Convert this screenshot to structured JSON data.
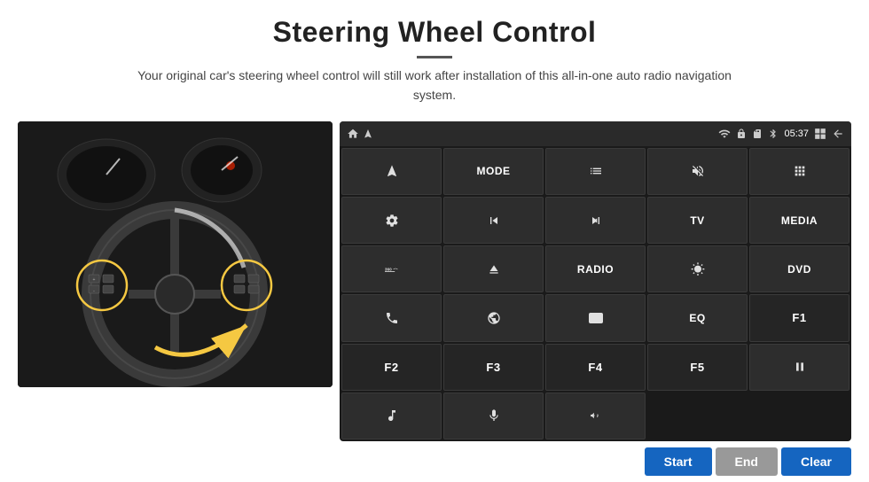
{
  "header": {
    "title": "Steering Wheel Control",
    "subtitle": "Your original car's steering wheel control will still work after installation of this all-in-one auto radio navigation system."
  },
  "statusBar": {
    "time": "05:37",
    "homeIcon": "home-icon",
    "wifiIcon": "wifi-icon",
    "lockIcon": "lock-icon",
    "sdIcon": "sd-icon",
    "bluetoothIcon": "bluetooth-icon",
    "windowsIcon": "windows-icon",
    "backIcon": "back-icon"
  },
  "panelButtons": [
    {
      "id": "b1",
      "type": "icon",
      "icon": "send-icon",
      "label": ""
    },
    {
      "id": "b2",
      "type": "text",
      "icon": "",
      "label": "MODE"
    },
    {
      "id": "b3",
      "type": "icon",
      "icon": "list-icon",
      "label": ""
    },
    {
      "id": "b4",
      "type": "icon",
      "icon": "mute-icon",
      "label": ""
    },
    {
      "id": "b5",
      "type": "icon",
      "icon": "grid-icon",
      "label": ""
    },
    {
      "id": "b6",
      "type": "icon",
      "icon": "settings-icon",
      "label": ""
    },
    {
      "id": "b7",
      "type": "icon",
      "icon": "prev-icon",
      "label": ""
    },
    {
      "id": "b8",
      "type": "icon",
      "icon": "next-icon",
      "label": ""
    },
    {
      "id": "b9",
      "type": "text",
      "icon": "",
      "label": "TV"
    },
    {
      "id": "b10",
      "type": "text",
      "icon": "",
      "label": "MEDIA"
    },
    {
      "id": "b11",
      "type": "icon",
      "icon": "360-icon",
      "label": ""
    },
    {
      "id": "b12",
      "type": "icon",
      "icon": "eject-icon",
      "label": ""
    },
    {
      "id": "b13",
      "type": "text",
      "icon": "",
      "label": "RADIO"
    },
    {
      "id": "b14",
      "type": "icon",
      "icon": "brightness-icon",
      "label": ""
    },
    {
      "id": "b15",
      "type": "text",
      "icon": "",
      "label": "DVD"
    },
    {
      "id": "b16",
      "type": "icon",
      "icon": "phone-icon",
      "label": ""
    },
    {
      "id": "b17",
      "type": "icon",
      "icon": "globe-icon",
      "label": ""
    },
    {
      "id": "b18",
      "type": "icon",
      "icon": "rect-icon",
      "label": ""
    },
    {
      "id": "b19",
      "type": "text",
      "icon": "",
      "label": "EQ"
    },
    {
      "id": "b20",
      "type": "text",
      "icon": "",
      "label": "F1"
    },
    {
      "id": "b21",
      "type": "text",
      "icon": "",
      "label": "F2"
    },
    {
      "id": "b22",
      "type": "text",
      "icon": "",
      "label": "F3"
    },
    {
      "id": "b23",
      "type": "text",
      "icon": "",
      "label": "F4"
    },
    {
      "id": "b24",
      "type": "text",
      "icon": "",
      "label": "F5"
    },
    {
      "id": "b25",
      "type": "icon",
      "icon": "play-pause-icon",
      "label": ""
    },
    {
      "id": "b26",
      "type": "icon",
      "icon": "music-icon",
      "label": ""
    },
    {
      "id": "b27",
      "type": "icon",
      "icon": "mic-icon",
      "label": ""
    },
    {
      "id": "b28",
      "type": "icon",
      "icon": "vol-phone-icon",
      "label": ""
    }
  ],
  "actionBar": {
    "startLabel": "Start",
    "endLabel": "End",
    "clearLabel": "Clear"
  }
}
